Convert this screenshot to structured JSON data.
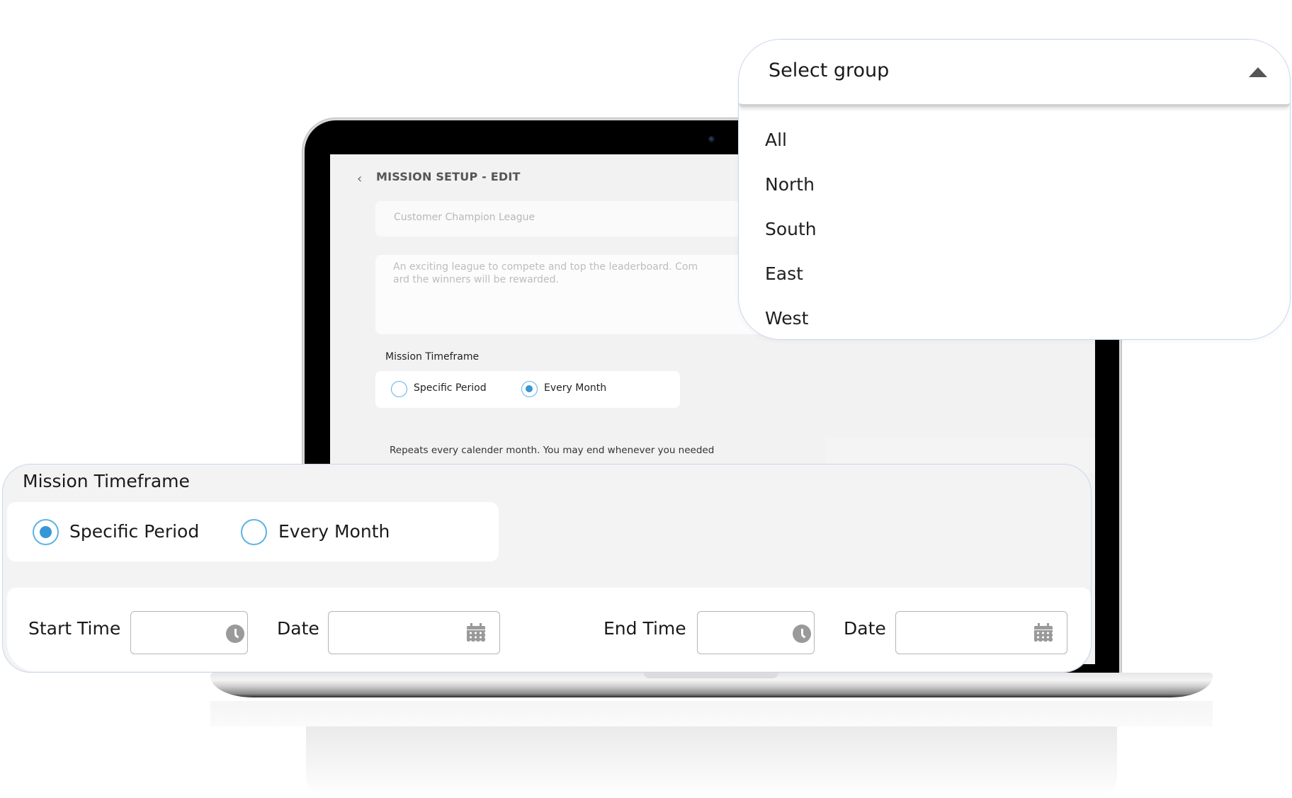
{
  "laptop_screen": {
    "back_icon": "chevron-left-icon",
    "page_title": "MISSION SETUP - EDIT",
    "mission_name_placeholder": "Customer Champion League",
    "mission_description": "An exciting league to compete and top the leaderboard. Com\nard the winners will be rewarded.",
    "timeframe_label": "Mission Timeframe",
    "timeframe_options": [
      {
        "label": "Specific Period",
        "selected": false
      },
      {
        "label": "Every Month",
        "selected": true
      }
    ],
    "repeat_note": "Repeats every calender month. You may end whenever you needed"
  },
  "group_dropdown": {
    "placeholder": "Select group",
    "state": "open",
    "arrow_icon": "caret-up-icon",
    "options": [
      "All",
      "North",
      "South",
      "East",
      "West"
    ]
  },
  "timeframe_panel": {
    "title": "Mission Timeframe",
    "options": [
      {
        "label": "Specific Period",
        "selected": true
      },
      {
        "label": "Every Month",
        "selected": false
      }
    ],
    "fields": {
      "start_time_label": "Start Time",
      "start_time_value": "",
      "start_date_label": "Date",
      "start_date_value": "",
      "end_time_label": "End Time",
      "end_time_value": "",
      "end_date_label": "Date",
      "end_date_value": ""
    }
  },
  "colors": {
    "accent": "#3598d6",
    "radio_border": "#5db3e6",
    "panel_border": "#c9d6ee",
    "icon_gray": "#9a9a9a"
  }
}
